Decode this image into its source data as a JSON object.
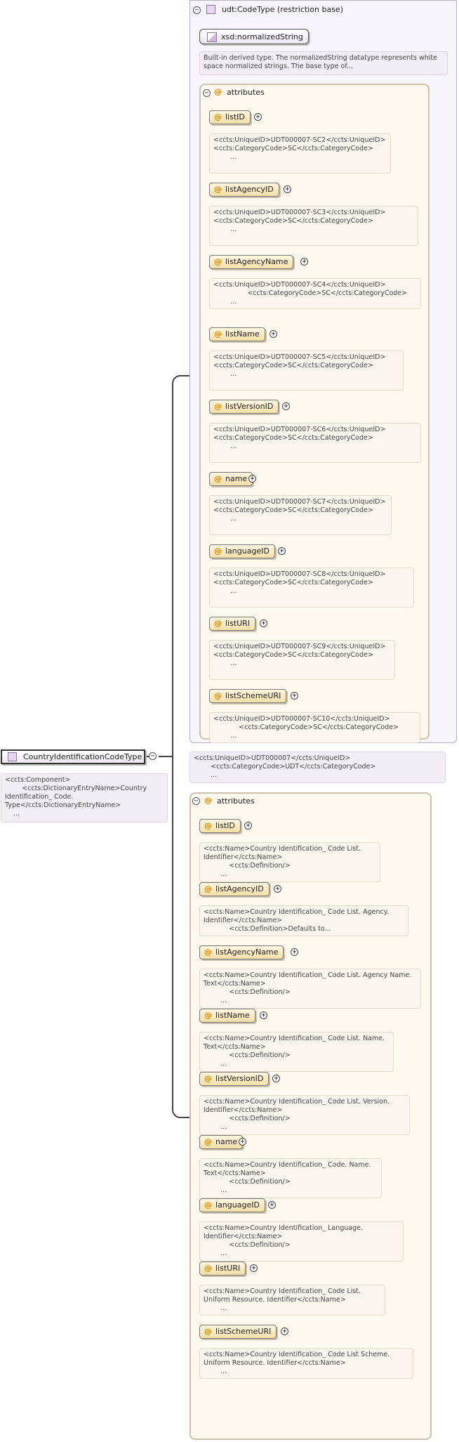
{
  "root": {
    "name": "CountryIdentificationCodeType",
    "note": [
      "<ccts:Component>",
      "        <ccts:DictionaryEntryName>Country",
      "Identification_ Code.",
      "Type</ccts:DictionaryEntryName>",
      "    ..."
    ]
  },
  "restriction": {
    "title": "udt:CodeType (restriction base)",
    "base_type": "xsd:normalizedString",
    "description": [
      "Built-in derived type. The normalizedString datatype represents white",
      "space normalized strings. The base type of..."
    ]
  },
  "section_label": "attributes",
  "attributes_base": [
    {
      "name": "listID",
      "note": [
        "<ccts:UniqueID>UDT000007-SC2</ccts:UniqueID>",
        "",
        "<ccts:CategoryCode>SC</ccts:CategoryCode>",
        "        ..."
      ]
    },
    {
      "name": "listAgencyID",
      "note": [
        "<ccts:UniqueID>UDT000007-SC3</ccts:UniqueID>",
        "",
        "<ccts:CategoryCode>SC</ccts:CategoryCode>",
        "        ..."
      ]
    },
    {
      "name": "listAgencyName",
      "note": [
        "<ccts:UniqueID>UDT000007-SC4</ccts:UniqueID>",
        "                <ccts:CategoryCode>SC</ccts:CategoryCode>",
        "        ..."
      ]
    },
    {
      "name": "listName",
      "note": [
        "<ccts:UniqueID>UDT000007-SC5</ccts:UniqueID>",
        "",
        "<ccts:CategoryCode>SC</ccts:CategoryCode>",
        "        ..."
      ]
    },
    {
      "name": "listVersionID",
      "note": [
        "<ccts:UniqueID>UDT000007-SC6</ccts:UniqueID>",
        "",
        "<ccts:CategoryCode>SC</ccts:CategoryCode>",
        "        ..."
      ]
    },
    {
      "name": "name",
      "note": [
        "<ccts:UniqueID>UDT000007-SC7</ccts:UniqueID>",
        "",
        "<ccts:CategoryCode>SC</ccts:CategoryCode>",
        "        ..."
      ]
    },
    {
      "name": "languageID",
      "note": [
        "<ccts:UniqueID>UDT000007-SC8</ccts:UniqueID>",
        "",
        "<ccts:CategoryCode>SC</ccts:CategoryCode>",
        "        ..."
      ]
    },
    {
      "name": "listURI",
      "note": [
        "<ccts:UniqueID>UDT000007-SC9</ccts:UniqueID>",
        "",
        "<ccts:CategoryCode>SC</ccts:CategoryCode>",
        "        ..."
      ]
    },
    {
      "name": "listSchemeURI",
      "note": [
        "<ccts:UniqueID>UDT000007-SC10</ccts:UniqueID>",
        "            <ccts:CategoryCode>SC</ccts:CategoryCode>",
        "        ..."
      ]
    }
  ],
  "type_note": [
    "<ccts:UniqueID>UDT000007</ccts:UniqueID>",
    "        <ccts:CategoryCode>UDT</ccts:CategoryCode>",
    "        ..."
  ],
  "attributes_local": [
    {
      "name": "listID",
      "note": [
        "<ccts:Name>Country Identification_ Code List.",
        "Identifier</ccts:Name>",
        "            <ccts:Definition/>",
        "        ..."
      ]
    },
    {
      "name": "listAgencyID",
      "note": [
        "<ccts:Name>Country Identification_ Code List. Agency.",
        "Identifier</ccts:Name>",
        "            <ccts:Definition>Defaults to..."
      ]
    },
    {
      "name": "listAgencyName",
      "note": [
        "<ccts:Name>Country Identification_ Code List. Agency Name.",
        "Text</ccts:Name>",
        "            <ccts:Definition/>",
        "        ..."
      ]
    },
    {
      "name": "listName",
      "note": [
        "<ccts:Name>Country Identification_ Code List. Name.",
        "Text</ccts:Name>",
        "            <ccts:Definition/>",
        "        ..."
      ]
    },
    {
      "name": "listVersionID",
      "note": [
        "<ccts:Name>Country Identification_ Code List. Version.",
        "Identifier</ccts:Name>",
        "            <ccts:Definition/>",
        "        ..."
      ]
    },
    {
      "name": "name",
      "note": [
        "<ccts:Name>Country Identification_ Code. Name.",
        "Text</ccts:Name>",
        "            <ccts:Definition/>",
        "        ..."
      ]
    },
    {
      "name": "languageID",
      "note": [
        "<ccts:Name>Country Identification_ Language.",
        "Identifier</ccts:Name>",
        "            <ccts:Definition/>",
        "        ..."
      ]
    },
    {
      "name": "listURI",
      "note": [
        "<ccts:Name>Country Identification_ Code List.",
        "Uniform Resource. Identifier</ccts:Name>",
        "        ..."
      ]
    },
    {
      "name": "listSchemeURI",
      "note": [
        "<ccts:Name>Country Identification_ Code List Scheme.",
        "Uniform Resource. Identifier</ccts:Name>",
        "        ..."
      ]
    }
  ]
}
